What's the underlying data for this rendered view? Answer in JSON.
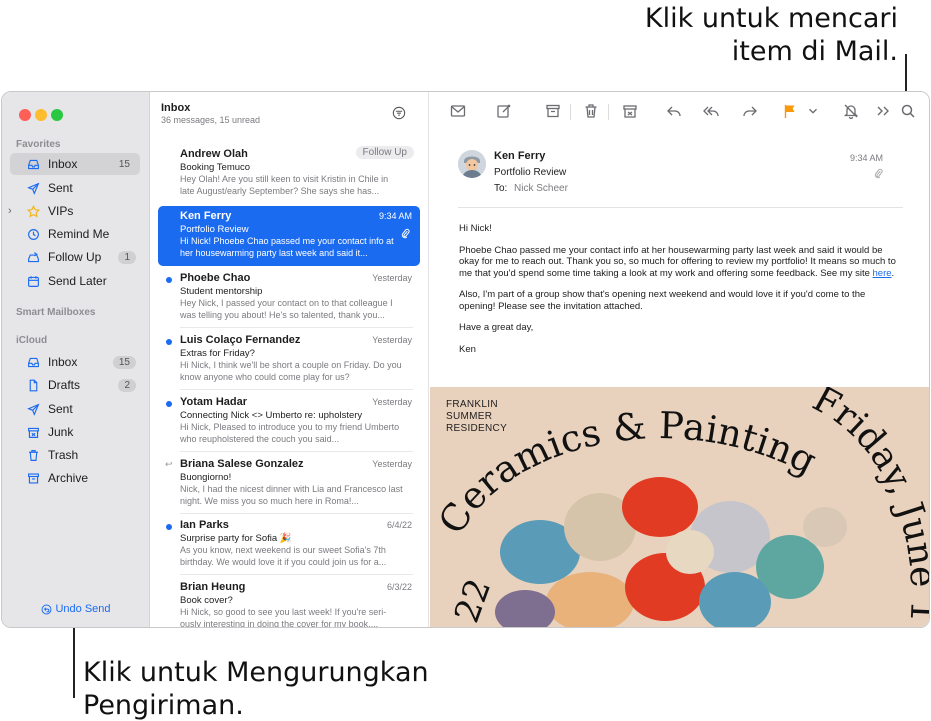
{
  "callouts": {
    "top_line1": "Klik untuk mencari",
    "top_line2": "item di Mail.",
    "bottom_line1": "Klik untuk Mengurungkan",
    "bottom_line2": "Pengiriman."
  },
  "sidebar": {
    "favorites_label": "Favorites",
    "smart_label": "Smart Mailboxes",
    "icloud_label": "iCloud",
    "favorites": [
      {
        "label": "Inbox",
        "icon": "inbox-icon",
        "count": "15"
      },
      {
        "label": "Sent",
        "icon": "paperplane-icon",
        "count": ""
      },
      {
        "label": "VIPs",
        "icon": "star-icon",
        "count": ""
      },
      {
        "label": "Remind Me",
        "icon": "clock-icon",
        "count": ""
      },
      {
        "label": "Follow Up",
        "icon": "follow-up-icon",
        "count": "1"
      },
      {
        "label": "Send Later",
        "icon": "calendar-icon",
        "count": ""
      }
    ],
    "icloud": [
      {
        "label": "Inbox",
        "icon": "inbox-icon",
        "count": "15"
      },
      {
        "label": "Drafts",
        "icon": "doc-icon",
        "count": "2"
      },
      {
        "label": "Sent",
        "icon": "paperplane-icon",
        "count": ""
      },
      {
        "label": "Junk",
        "icon": "junk-icon",
        "count": ""
      },
      {
        "label": "Trash",
        "icon": "trash-icon",
        "count": ""
      },
      {
        "label": "Archive",
        "icon": "archive-icon",
        "count": ""
      }
    ],
    "undo_send": "Undo Send"
  },
  "list": {
    "title": "Inbox",
    "subtitle": "36 messages, 15 unread",
    "messages": [
      {
        "from": "Andrew Olah",
        "date": "",
        "badge": "Follow Up",
        "subject": "Booking Temuco",
        "preview": "Hey Olah! Are you still keen to visit Kristin in Chile in late August/early September? She says she has...",
        "unread": false,
        "replied": false
      },
      {
        "from": "Ken Ferry",
        "date": "9:34 AM",
        "badge": "",
        "subject": "Portfolio Review",
        "preview": "Hi Nick! Phoebe Chao passed me your contact info at her housewarming party last week and said it...",
        "unread": false,
        "replied": false
      },
      {
        "from": "Phoebe Chao",
        "date": "Yesterday",
        "badge": "",
        "subject": "Student mentorship",
        "preview": "Hey Nick, I passed your contact on to that colleague I was telling you about! He's so talented, thank you...",
        "unread": true,
        "replied": false
      },
      {
        "from": "Luis Colaço Fernandez",
        "date": "Yesterday",
        "badge": "",
        "subject": "Extras for Friday?",
        "preview": "Hi Nick, I think we'll be short a couple on Friday. Do you know anyone who could come play for us?",
        "unread": true,
        "replied": false
      },
      {
        "from": "Yotam Hadar",
        "date": "Yesterday",
        "badge": "",
        "subject": "Connecting Nick <> Umberto re: upholstery",
        "preview": "Hi Nick, Pleased to introduce you to my friend Umberto who reupholstered the couch you said...",
        "unread": true,
        "replied": false
      },
      {
        "from": "Briana Salese Gonzalez",
        "date": "Yesterday",
        "badge": "",
        "subject": "Buongiorno!",
        "preview": "Nick, I had the nicest dinner with Lia and Francesco last night. We miss you so much here in Roma!...",
        "unread": false,
        "replied": true
      },
      {
        "from": "Ian Parks",
        "date": "6/4/22",
        "badge": "",
        "subject": "Surprise party for Sofia 🎉",
        "preview": "As you know, next weekend is our sweet Sofia's 7th birthday. We would love it if you could join us for a...",
        "unread": true,
        "replied": false
      },
      {
        "from": "Brian Heung",
        "date": "6/3/22",
        "badge": "",
        "subject": "Book cover?",
        "preview": "Hi Nick, so good to see you last week! If you're seri-ously interesting in doing the cover for my book,...",
        "unread": false,
        "replied": false
      }
    ]
  },
  "reader": {
    "from": "Ken Ferry",
    "subject": "Portfolio Review",
    "to_label": "To:",
    "to": "Nick Scheer",
    "time": "9:34 AM",
    "greeting": "Hi Nick!",
    "para1": "Phoebe Chao passed me your contact info at her housewarming party last week and said it would be okay for me to reach out. Thank you so, so much for offering to review my portfolio! It means so much to me that you'd spend some time taking a look at my work and offering some feedback. See my site",
    "link": "here",
    "para1_end": ".",
    "para2": "Also, I'm part of a group show that's opening next weekend and would love it if you'd come to the opening! Please see the invitation attached.",
    "para3": "Have a great day,",
    "sign": "Ken",
    "poster": {
      "small_line1": "FRANKLIN",
      "small_line2": "SUMMER",
      "small_line3": "RESIDENCY",
      "arc_text": "Ceramics & Painting",
      "side_text": "Friday, June 1",
      "left_text": "22"
    }
  },
  "colors": {
    "accent": "#1b6bf1",
    "flag": "#f79a0b"
  }
}
